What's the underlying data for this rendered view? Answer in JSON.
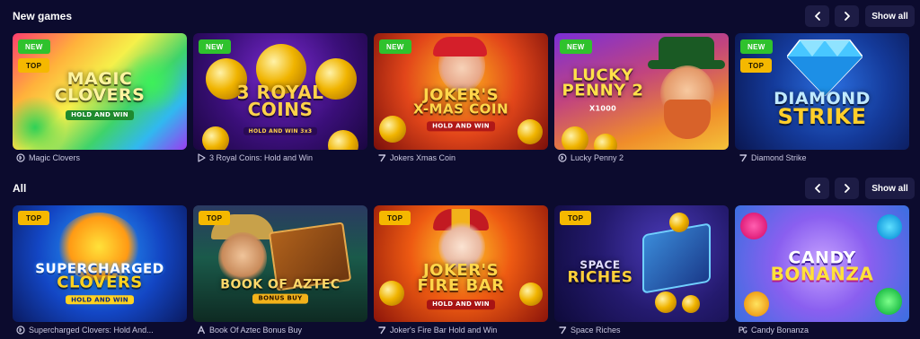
{
  "sections": [
    {
      "title": "New games",
      "show_all_label": "Show all",
      "games": [
        {
          "name": "Magic Clovers",
          "art_title": [
            "MAGIC",
            "CLOVERS"
          ],
          "art_sub": "HOLD AND WIN",
          "badges": [
            "NEW",
            "TOP"
          ],
          "provider_icon": "provider-d-icon"
        },
        {
          "name": "3 Royal Coins: Hold and Win",
          "art_title": [
            "3 ROYAL",
            "COINS"
          ],
          "art_sub": "HOLD AND WIN 3x3",
          "badges": [
            "NEW"
          ],
          "provider_icon": "provider-play-icon"
        },
        {
          "name": "Jokers Xmas Coin",
          "art_title": [
            "JOKER'S",
            "X-MAS COIN"
          ],
          "art_sub": "HOLD AND WIN",
          "badges": [
            "NEW"
          ],
          "provider_icon": "provider-seven-icon"
        },
        {
          "name": "Lucky Penny 2",
          "art_title": [
            "LUCKY",
            "PENNY 2"
          ],
          "art_sub": "X1000",
          "badges": [
            "NEW"
          ],
          "provider_icon": "provider-d-icon"
        },
        {
          "name": "Diamond Strike",
          "art_title": [
            "DIAMOND",
            "STRIKE"
          ],
          "art_sub": "",
          "badges": [
            "NEW",
            "TOP"
          ],
          "provider_icon": "provider-seven-icon"
        }
      ]
    },
    {
      "title": "All",
      "show_all_label": "Show all",
      "games": [
        {
          "name": "Supercharged Clovers: Hold And...",
          "art_title": [
            "SUPERCHARGED",
            "CLOVERS"
          ],
          "art_sub": "HOLD AND WIN",
          "badges": [
            "TOP"
          ],
          "provider_icon": "provider-d-icon"
        },
        {
          "name": "Book Of Aztec Bonus Buy",
          "art_title": [
            "BOOK OF AZTEC",
            ""
          ],
          "art_sub": "BONUS BUY",
          "badges": [
            "TOP"
          ],
          "provider_icon": "provider-a-icon"
        },
        {
          "name": "Joker's Fire Bar Hold and Win",
          "art_title": [
            "JOKER'S",
            "FIRE BAR"
          ],
          "art_sub": "HOLD AND WIN",
          "badges": [
            "TOP"
          ],
          "provider_icon": "provider-seven-icon"
        },
        {
          "name": "Space Riches",
          "art_title": [
            "SPACE",
            "RICHES"
          ],
          "art_sub": "",
          "badges": [
            "TOP"
          ],
          "provider_icon": "provider-seven-icon"
        },
        {
          "name": "Candy Bonanza",
          "art_title": [
            "CANDY",
            "BONANZA"
          ],
          "art_sub": "",
          "badges": [],
          "provider_icon": "provider-pg-icon"
        }
      ]
    }
  ],
  "colors": {
    "page_background": "#0c0b2e",
    "button_background": "#1d1c45",
    "badge_new": "#2fc22d",
    "badge_top": "#f5b800",
    "caption_text": "#c9c8e0"
  }
}
